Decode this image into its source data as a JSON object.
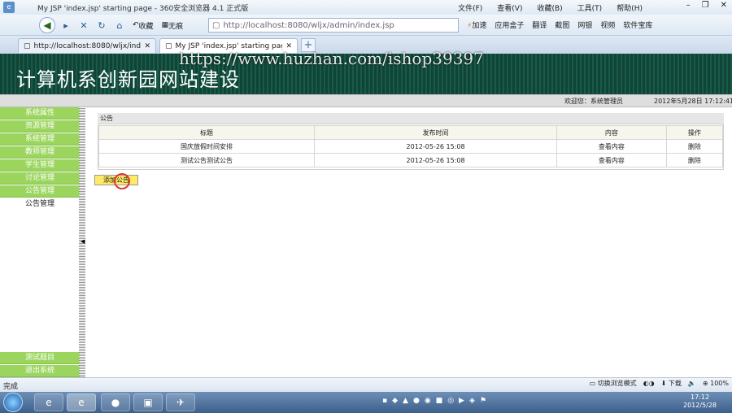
{
  "window": {
    "title": "My JSP 'index.jsp' starting page - 360安全浏览器 4.1 正式版",
    "menu": [
      "文件(F)",
      "查看(V)",
      "收藏(B)",
      "工具(T)",
      "帮助(H)"
    ]
  },
  "navbar": {
    "favorite_btn": "收藏",
    "no_trace_btn": "无痕",
    "address": "http://localhost:8080/wljx/admin/index.jsp",
    "accelerate": "加速",
    "tools": [
      "应用盒子",
      "翻译",
      "截图",
      "网银",
      "视频",
      "软件宝库"
    ]
  },
  "tabs": [
    {
      "label": "http://localhost:8080/wljx/index.js..."
    },
    {
      "label": "My JSP 'index.jsp' starting page"
    }
  ],
  "page": {
    "banner_title": "计算机系创新园网站建设",
    "watermark": "https://www.huzhan.com/ishop39397",
    "welcome": "欢迎您：系统管理员",
    "datetime": "2012年5月28日  17:12:41"
  },
  "sidebar": {
    "items": [
      {
        "label": "系统属性"
      },
      {
        "label": "资源管理"
      },
      {
        "label": "系统管理"
      },
      {
        "label": "教师管理"
      },
      {
        "label": "学生管理"
      },
      {
        "label": "讨论管理"
      },
      {
        "label": "公告管理"
      },
      {
        "label": "公告管理"
      }
    ],
    "bottom_items": [
      {
        "label": "测试题目"
      },
      {
        "label": "退出系统"
      }
    ]
  },
  "notice_panel": {
    "title": "公告",
    "columns": [
      "标题",
      "发布时间",
      "内容",
      "操作"
    ],
    "rows": [
      {
        "title": "国庆放假时间安排",
        "date": "2012-05-26 15:08",
        "content": "查看内容",
        "action": "删除"
      },
      {
        "title": "测试公告测试公告",
        "date": "2012-05-26 15:08",
        "content": "查看内容",
        "action": "删除"
      }
    ],
    "add_button": "添加公告"
  },
  "statusbar": {
    "left": "完成",
    "switch_mode": "切换浏览模式",
    "download": "下载",
    "zoom": "100%"
  },
  "taskbar": {
    "time": "17:12",
    "date": "2012/5/28"
  }
}
